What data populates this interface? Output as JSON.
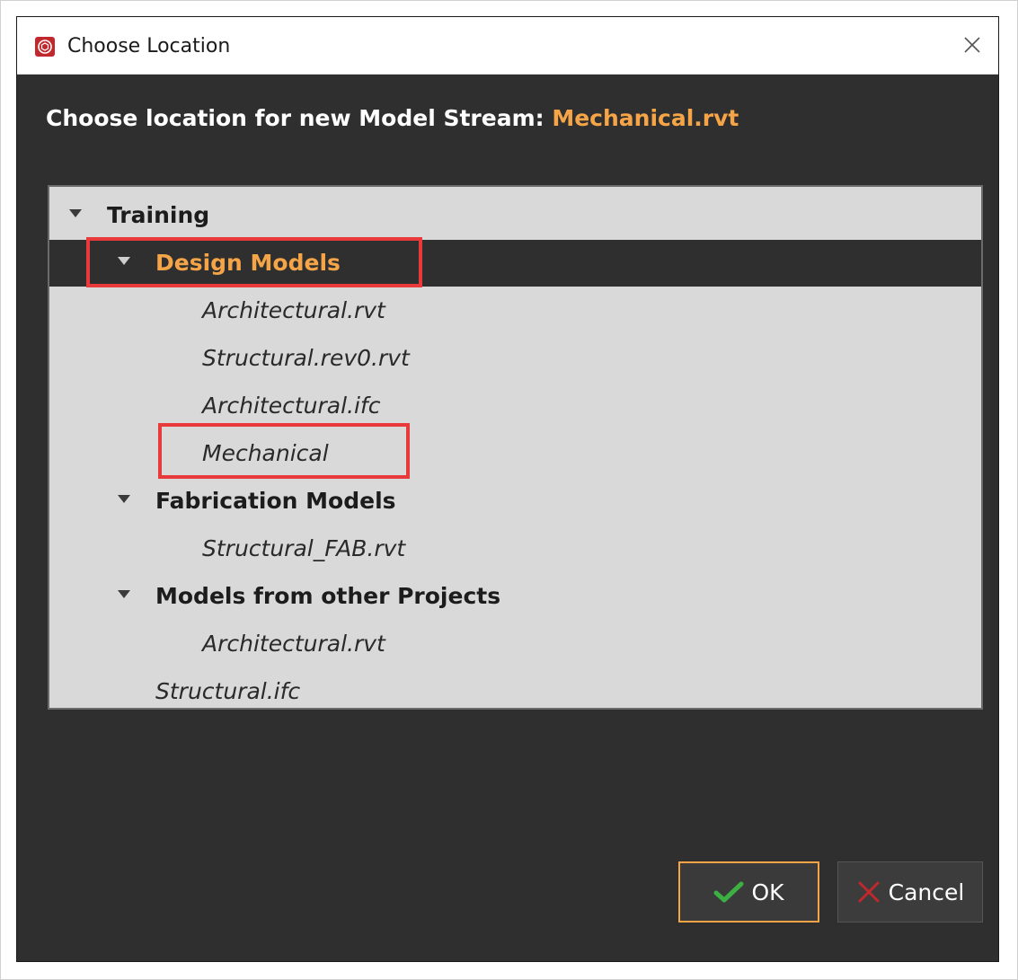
{
  "window": {
    "title": "Choose Location",
    "close_icon": "close-icon",
    "app_icon": "app-logo-icon"
  },
  "heading": {
    "prefix": "Choose location for new Model Stream: ",
    "filename": "Mechanical.rvt"
  },
  "tree": {
    "items": [
      {
        "label": "Training",
        "style": "bold",
        "expanded": true
      },
      {
        "label": "Design Models",
        "style": "bold",
        "expanded": true,
        "selected": true
      },
      {
        "label": "Architectural.rvt",
        "style": "italic"
      },
      {
        "label": "Structural.rev0.rvt",
        "style": "italic"
      },
      {
        "label": "Architectural.ifc",
        "style": "italic"
      },
      {
        "label": "Mechanical",
        "style": "italic"
      },
      {
        "label": "Fabrication Models",
        "style": "bold",
        "expanded": true
      },
      {
        "label": "Structural_FAB.rvt",
        "style": "italic"
      },
      {
        "label": "Models from other Projects",
        "style": "bold",
        "expanded": true
      },
      {
        "label": "Architectural.rvt",
        "style": "italic"
      },
      {
        "label": "Structural.ifc",
        "style": "italic"
      }
    ]
  },
  "buttons": {
    "ok": {
      "label": "OK",
      "icon": "checkmark-icon"
    },
    "cancel": {
      "label": "Cancel",
      "icon": "x-cross-icon"
    }
  },
  "colors": {
    "accent": "#f5a547",
    "dialog_bg": "#2f2f2f",
    "tree_bg": "#d9d9d9",
    "highlight": "#e83a3a",
    "ok_check": "#3cb043",
    "cancel_x": "#c0282d"
  }
}
